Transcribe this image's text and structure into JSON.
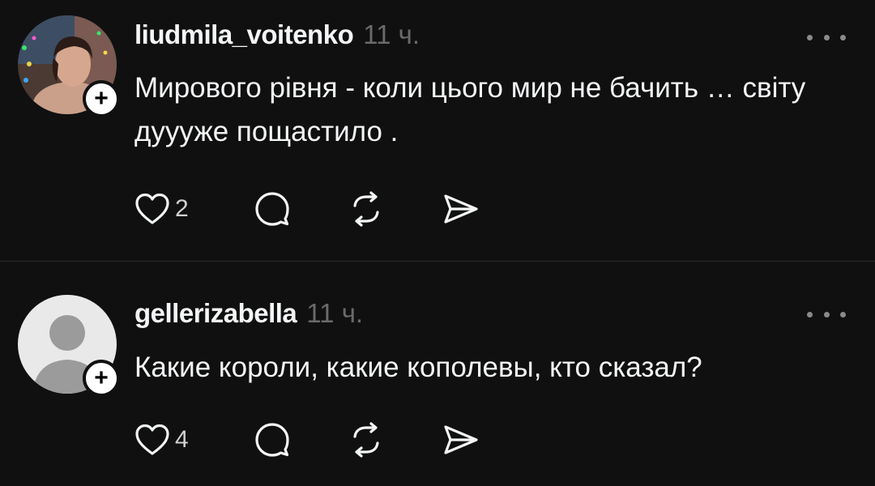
{
  "posts": [
    {
      "username": "liudmila_voitenko",
      "time": "11 ч.",
      "text": "Мирового рівня - коли цього мир не бачить … світу дуууже пощастило .",
      "likes": "2",
      "avatar": "photo"
    },
    {
      "username": "gellerizabella",
      "time": "11 ч.",
      "text": "Какие короли, какие кополевы, кто сказал?",
      "likes": "4",
      "avatar": "default-silhouette"
    }
  ],
  "icons": {
    "follow": "plus-icon",
    "more": "more-dots-icon",
    "like": "heart-icon",
    "reply": "comment-icon",
    "repost": "repost-icon",
    "share": "send-icon"
  },
  "colors": {
    "background": "#101010",
    "text": "#f3f5f7",
    "muted": "#6a6a6a",
    "divider": "#2a2a2a"
  }
}
